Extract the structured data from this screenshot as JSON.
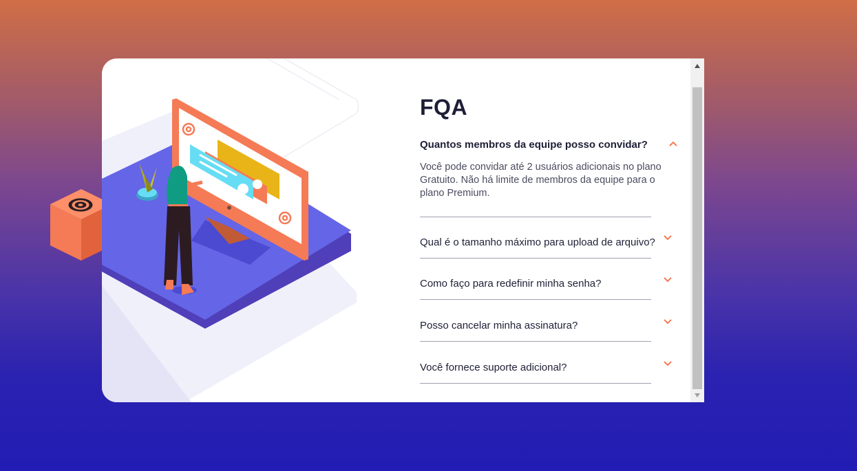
{
  "faq": {
    "title": "FQA",
    "items": [
      {
        "question": "Quantos membros da equipe posso convidar?",
        "answer": "Você pode convidar até 2 usuários adicionais no plano Gratuito. Não há limite de membros da equipe para o plano Premium.",
        "expanded": true
      },
      {
        "question": "Qual é o tamanho máximo para upload de arquivo?",
        "expanded": false
      },
      {
        "question": "Como faço para redefinir minha senha?",
        "expanded": false
      },
      {
        "question": "Posso cancelar minha assinatura?",
        "expanded": false
      },
      {
        "question": "Você fornece suporte adicional?",
        "expanded": false
      }
    ]
  },
  "colors": {
    "accent": "#f47b56",
    "text_dark": "#1e1f36",
    "text_muted": "#4b4c5f",
    "platform": "#6565e7",
    "cube": "#f47b56"
  },
  "icons": {
    "chevron": "chevron-icon",
    "at": "at-sign-icon"
  }
}
